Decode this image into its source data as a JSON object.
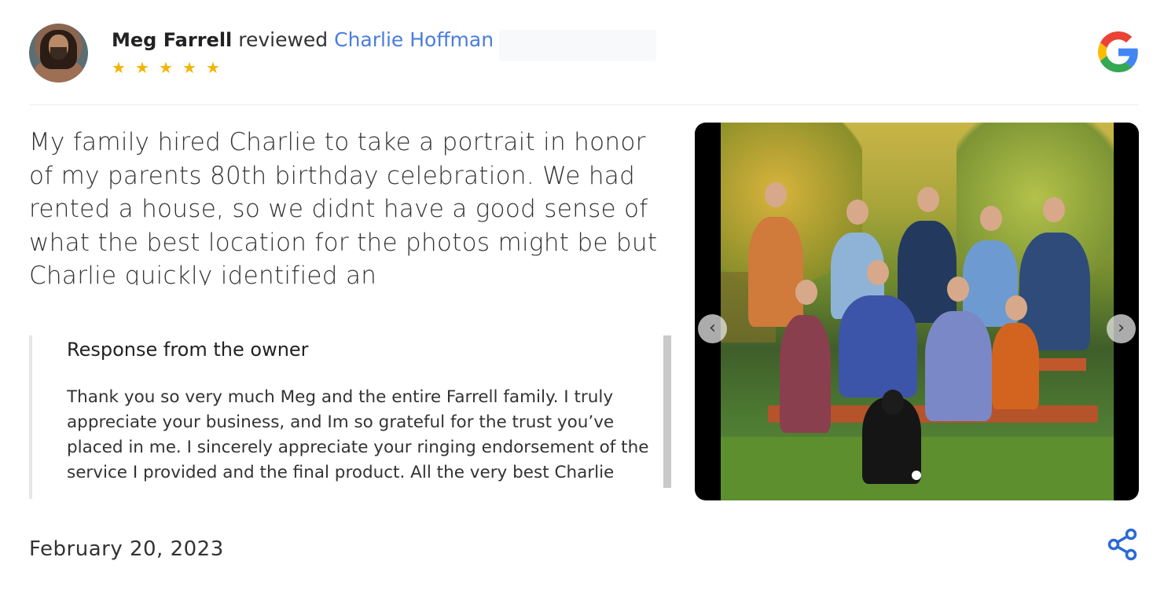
{
  "review": {
    "reviewer_name": "Meg Farrell",
    "reviewed_word": "reviewed",
    "business_name": "Charlie Hoffman",
    "rating": 5,
    "text": "My family hired Charlie to take a portrait in honor of my parents 80th birthday celebration. We had rented a house, so we didnt have a good sense of what the best location for the photos might be but Charlie quickly identified an",
    "date": "February 20, 2023"
  },
  "response": {
    "title": "Response from the owner",
    "body": "Thank you so very much Meg and the entire Farrell family. I truly appreciate your business, and Im so grateful for the trust you’ve placed in me. I sincerely appreciate your ringing endorsement of the service I provided and the final product. All the very best Charlie"
  },
  "gallery": {
    "prev_glyph": "‹",
    "next_glyph": "›",
    "active_index": 1,
    "count": 1
  },
  "icons": {
    "star": "★",
    "google_colors": [
      "#4285F4",
      "#EA4335",
      "#FBBC05",
      "#34A853"
    ],
    "star_color": "#f4b400",
    "link_color": "#4a7ddd",
    "share_color": "#2a6ad4"
  }
}
